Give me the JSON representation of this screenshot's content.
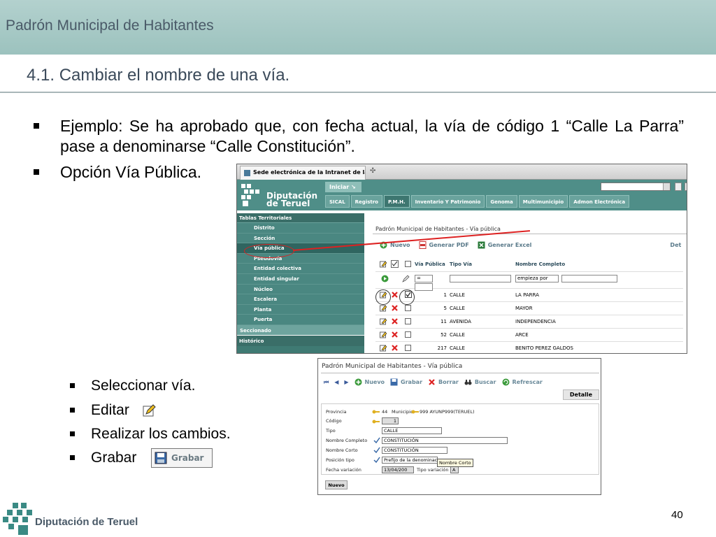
{
  "header": {
    "brand": "Padrón Municipal de Habitantes",
    "section_title": "4.1. Cambiar el nombre de una vía."
  },
  "bullets": [
    "Ejemplo: Se ha aprobado que, con fecha actual, la vía de código 1 “Calle La Parra” pase a denominarse “Calle Constitución”.",
    "Opción Vía Pública."
  ],
  "sub_bullets": [
    "Seleccionar vía.",
    "Editar",
    "Realizar los cambios.",
    "Grabar"
  ],
  "grabar_label": "Grabar",
  "shot1": {
    "tab_title": "Sede electrónica de la Intranet de la...",
    "logo_text_1": "Diputación",
    "logo_text_2": "de Teruel",
    "iniciar": "Iniciar ↘",
    "nav_tabs": [
      "SICAL",
      "Registro",
      "P.M.H.",
      "Inventario Y Patrimonio",
      "Genoma",
      "Multimunicipio",
      "Admon Electrónica"
    ],
    "sidebar": {
      "header": "Tablas Territoriales",
      "items": [
        "Distrito",
        "Sección",
        "Vía pública",
        "Pseudovía",
        "Entidad colectiva",
        "Entidad singular",
        "Núcleo",
        "Escalera",
        "Planta",
        "Puerta"
      ],
      "footer1": "Seccionado",
      "footer2": "Histórico"
    },
    "page_title": "Padrón Municipal de Habitantes - Vía pública",
    "toolbar": {
      "nuevo": "Nuevo",
      "pdf": "Generar PDF",
      "excel": "Generar Excel",
      "det": "Det"
    },
    "columns": {
      "via": "Vía Pública",
      "tipo": "Tipo Vía",
      "nombre": "Nombre Completo"
    },
    "filter": {
      "op": "=",
      "match": "empieza por"
    },
    "rows": [
      {
        "num": "1",
        "tipo": "CALLE",
        "nombre": "LA PARRA"
      },
      {
        "num": "5",
        "tipo": "CALLE",
        "nombre": "MAYOR"
      },
      {
        "num": "11",
        "tipo": "AVENIDA",
        "nombre": "INDEPENDENCIA"
      },
      {
        "num": "52",
        "tipo": "CALLE",
        "nombre": "ARCE"
      },
      {
        "num": "217",
        "tipo": "CALLE",
        "nombre": "BENITO PEREZ GALDOS"
      }
    ]
  },
  "shot2": {
    "page_title": "Padrón Municipal de Habitantes - Vía pública",
    "toolbar": {
      "nuevo": "Nuevo",
      "grabar": "Grabar",
      "borrar": "Borrar",
      "buscar": "Buscar",
      "refrescar": "Refrescar"
    },
    "detalle": "Detalle",
    "form": {
      "provincia_label": "Provincia",
      "provincia_value": "44",
      "municipio_label": "Municipio",
      "municipio_value": "999 AYUNP999(TERUEL)",
      "codigo_label": "Código",
      "codigo_value": "1",
      "tipo_label": "Tipo",
      "tipo_value": "CALLE",
      "nombre_completo_label": "Nombre Completo",
      "nombre_completo_value": "CONSTITUCIÓN",
      "nombre_corto_label": "Nombre Corto",
      "nombre_corto_value": "CONSTITUCIÓN",
      "posicion_label": "Posición tipo",
      "posicion_value": "Prefijo de la denominac",
      "fecha_label": "Fecha variación",
      "fecha_value": "13/04/200",
      "tipo_variacion_label": "Tipo variación",
      "tipo_variacion_value": "A"
    },
    "tooltip": "Nombre Corto",
    "nuevo_button": "Nuevo"
  },
  "footer": {
    "org": "Diputación de Teruel",
    "page": "40"
  },
  "colors": {
    "header_bg": "#9cc2be",
    "app_green": "#4f8e88",
    "sidebar_green": "#3f7a73",
    "annotation_red": "#d22222"
  }
}
